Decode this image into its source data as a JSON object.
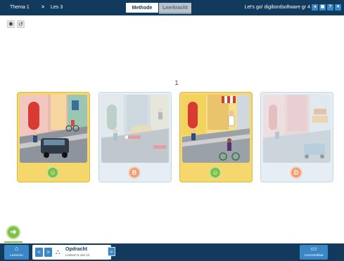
{
  "header": {
    "breadcrumb_thema": "Thema 1",
    "breadcrumb_separator": ">",
    "breadcrumb_les": "Les 3",
    "tab_methode": "Methode",
    "tab_leerkracht": "Leerkracht",
    "app_title": "Let's go! digibordsoftware gr 4",
    "btn_1": "◂",
    "btn_2": "▣",
    "btn_3": "?",
    "btn_4": "✕"
  },
  "tools": {
    "gear": "✱",
    "undo": "↺"
  },
  "page_number": "1",
  "cards": [
    {
      "badge": "☺",
      "state": "selected"
    },
    {
      "badge": "B",
      "state": "unselected"
    },
    {
      "badge": "☺",
      "state": "selected"
    },
    {
      "badge": "D",
      "state": "unselected"
    }
  ],
  "footer": {
    "home_icon": "⌂",
    "home_label": "Lesmenu",
    "prev": "<",
    "next": ">",
    "nav_icon": "⛬",
    "nav_title": "Opdracht",
    "nav_sub": "Lesitem 5 van 14",
    "expand": "»",
    "corr_icon": "▭",
    "corr_label": "Correctieblad"
  },
  "next_button": "➔",
  "colors": {
    "bar": "#123a5c",
    "accent_blue": "#3b86c4",
    "green": "#7cc144",
    "orange": "#f1a071",
    "selected_card": "#f6d76b",
    "unselected_card": "#e5eef5"
  }
}
